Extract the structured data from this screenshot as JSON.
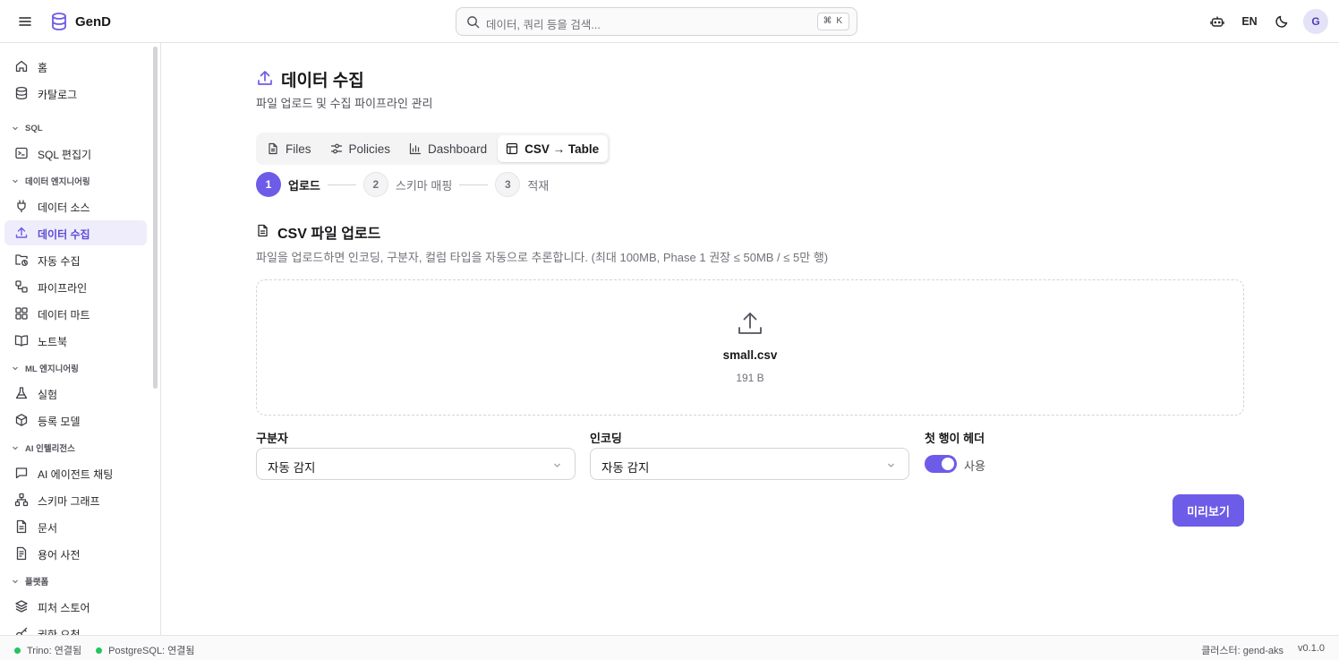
{
  "app": {
    "name": "GenD"
  },
  "search": {
    "placeholder": "데이터, 쿼리 등을 검색...",
    "shortcut": "⌘ K"
  },
  "header": {
    "language": "EN",
    "avatar_initial": "G"
  },
  "sidebar": {
    "items": [
      {
        "label": "홈",
        "icon": "home-icon"
      },
      {
        "label": "카탈로그",
        "icon": "database-icon"
      }
    ],
    "groups": [
      {
        "title": "SQL",
        "items": [
          {
            "label": "SQL 편집기",
            "icon": "sql-editor-icon"
          }
        ]
      },
      {
        "title": "데이터 엔지니어링",
        "items": [
          {
            "label": "데이터 소스",
            "icon": "plug-icon"
          },
          {
            "label": "데이터 수집",
            "icon": "upload-icon",
            "active": true
          },
          {
            "label": "자동 수집",
            "icon": "folder-sync-icon"
          },
          {
            "label": "파이프라인",
            "icon": "workflow-icon"
          },
          {
            "label": "데이터 마트",
            "icon": "grid-icon"
          },
          {
            "label": "노트북",
            "icon": "book-open-icon"
          }
        ]
      },
      {
        "title": "ML 엔지니어링",
        "items": [
          {
            "label": "실험",
            "icon": "flask-icon"
          },
          {
            "label": "등록 모델",
            "icon": "box-icon"
          }
        ]
      },
      {
        "title": "AI 인텔리전스",
        "items": [
          {
            "label": "AI 에이전트 채팅",
            "icon": "chat-icon"
          },
          {
            "label": "스키마 그래프",
            "icon": "network-icon"
          },
          {
            "label": "문서",
            "icon": "document-icon"
          },
          {
            "label": "용어 사전",
            "icon": "glossary-icon"
          }
        ]
      },
      {
        "title": "플랫폼",
        "items": [
          {
            "label": "피처 스토어",
            "icon": "layers-icon"
          },
          {
            "label": "권한 요청",
            "icon": "key-icon"
          }
        ]
      }
    ]
  },
  "page": {
    "title": "데이터 수집",
    "subtitle": "파일 업로드 및 수집 파이프라인 관리"
  },
  "tabs": [
    {
      "label": "Files",
      "icon": "file-icon"
    },
    {
      "label": "Policies",
      "icon": "sliders-icon"
    },
    {
      "label": "Dashboard",
      "icon": "bar-chart-icon"
    },
    {
      "label": "CSV → Table",
      "icon": "table-icon",
      "active": true
    }
  ],
  "steps": [
    {
      "num": "1",
      "label": "업로드",
      "active": true
    },
    {
      "num": "2",
      "label": "스키마 매핑",
      "active": false
    },
    {
      "num": "3",
      "label": "적재",
      "active": false
    }
  ],
  "upload": {
    "title": "CSV 파일 업로드",
    "description": "파일을 업로드하면 인코딩, 구분자, 컬럼 타입을 자동으로 추론합니다. (최대 100MB, Phase 1 권장 ≤ 50MB / ≤ 5만 행)",
    "file_name": "small.csv",
    "file_size": "191 B"
  },
  "options": {
    "delimiter_label": "구분자",
    "delimiter_value": "자동 감지",
    "encoding_label": "인코딩",
    "encoding_value": "자동 감지",
    "header_label": "첫 행이 헤더",
    "header_toggle_label": "사용",
    "header_enabled": true
  },
  "actions": {
    "preview": "미리보기"
  },
  "footer": {
    "trino": "Trino: 연결됨",
    "postgres": "PostgreSQL: 연결됨",
    "cluster": "클러스터: gend-aks",
    "version": "v0.1.0"
  },
  "colors": {
    "accent": "#6d5ce8",
    "status_ok": "#22c55e"
  }
}
